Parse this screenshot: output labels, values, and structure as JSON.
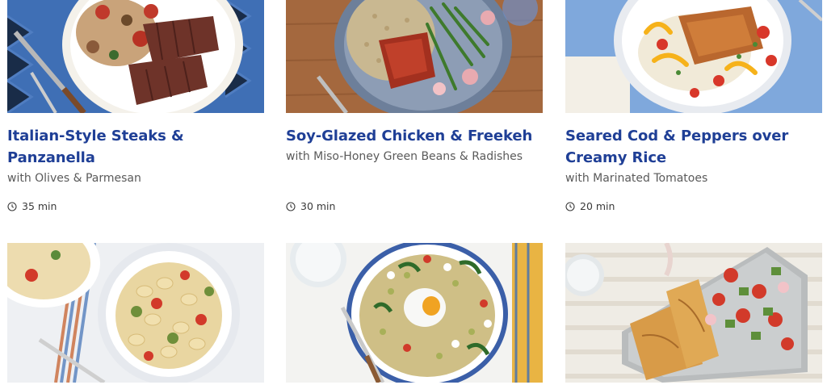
{
  "recipes": [
    {
      "title": "Italian-Style Steaks & Panzanella",
      "subtitle": "with Olives & Parmesan",
      "time": "35 min",
      "image": "steak-panzanella-photo"
    },
    {
      "title": "Soy-Glazed Chicken & Freekeh",
      "subtitle": "with Miso-Honey Green Beans & Radishes",
      "time": "30 min",
      "image": "soy-glazed-chicken-photo"
    },
    {
      "title": "Seared Cod & Peppers over Creamy Rice",
      "subtitle": "with Marinated Tomatoes",
      "time": "20 min",
      "image": "seared-cod-photo"
    },
    {
      "image": "gnocchi-vegetables-photo"
    },
    {
      "image": "grain-bowl-egg-photo"
    },
    {
      "image": "quesadilla-salad-photo"
    }
  ],
  "colors": {
    "title": "#1f3f96",
    "subtitle": "#5a5a5a",
    "time": "#3a3a3a"
  },
  "icons": {
    "time": "clock-icon"
  }
}
